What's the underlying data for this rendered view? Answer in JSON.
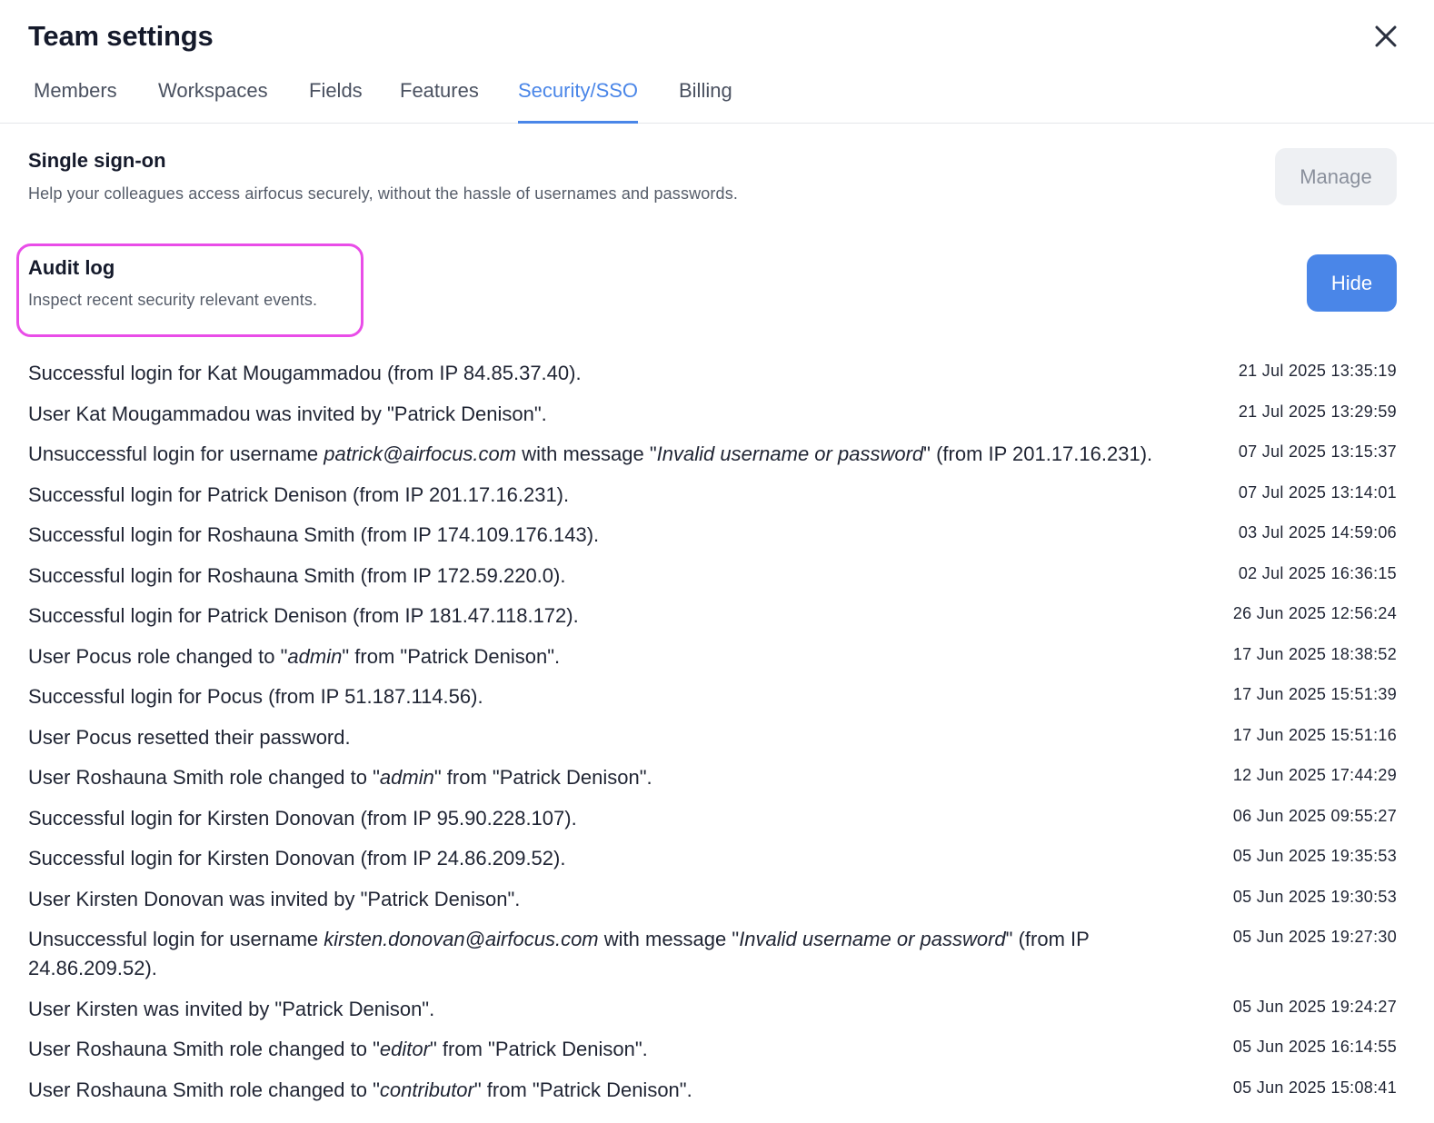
{
  "dialog": {
    "title": "Team settings",
    "close_icon": "close-icon"
  },
  "tabs": [
    {
      "label": "Members",
      "active": false
    },
    {
      "label": "Workspaces",
      "active": false
    },
    {
      "label": "Fields",
      "active": false
    },
    {
      "label": "Features",
      "active": false
    },
    {
      "label": "Security/SSO",
      "active": true
    },
    {
      "label": "Billing",
      "active": false
    }
  ],
  "sso": {
    "title": "Single sign-on",
    "description": "Help your colleagues access airfocus securely, without the hassle of usernames and passwords.",
    "button_label": "Manage"
  },
  "audit": {
    "title": "Audit log",
    "description": "Inspect recent security relevant events.",
    "button_label": "Hide"
  },
  "colors": {
    "accent": "#4a86e8",
    "highlight": "#e94de8",
    "disabled_button_bg": "#eef0f3"
  },
  "log_entries": [
    {
      "parts": [
        {
          "t": "Successful login for Kat Mougammadou (from IP 84.85.37.40)."
        }
      ],
      "time": "21 Jul 2025 13:35:19"
    },
    {
      "parts": [
        {
          "t": "User Kat Mougammadou was invited by \"Patrick Denison\"."
        }
      ],
      "time": "21 Jul 2025 13:29:59"
    },
    {
      "parts": [
        {
          "t": "Unsuccessful login for username "
        },
        {
          "t": "patrick@airfocus.com",
          "i": true
        },
        {
          "t": " with message \""
        },
        {
          "t": "Invalid username or password",
          "i": true
        },
        {
          "t": "\" (from IP 201.17.16.231)."
        }
      ],
      "time": "07 Jul 2025 13:15:37"
    },
    {
      "parts": [
        {
          "t": "Successful login for Patrick Denison (from IP 201.17.16.231)."
        }
      ],
      "time": "07 Jul 2025 13:14:01"
    },
    {
      "parts": [
        {
          "t": "Successful login for Roshauna Smith (from IP 174.109.176.143)."
        }
      ],
      "time": "03 Jul 2025 14:59:06"
    },
    {
      "parts": [
        {
          "t": "Successful login for Roshauna Smith (from IP 172.59.220.0)."
        }
      ],
      "time": "02 Jul 2025 16:36:15"
    },
    {
      "parts": [
        {
          "t": "Successful login for Patrick Denison (from IP 181.47.118.172)."
        }
      ],
      "time": "26 Jun 2025 12:56:24"
    },
    {
      "parts": [
        {
          "t": "User Pocus role changed to \""
        },
        {
          "t": "admin",
          "i": true
        },
        {
          "t": "\" from \"Patrick Denison\"."
        }
      ],
      "time": "17 Jun 2025 18:38:52"
    },
    {
      "parts": [
        {
          "t": "Successful login for Pocus (from IP 51.187.114.56)."
        }
      ],
      "time": "17 Jun 2025 15:51:39"
    },
    {
      "parts": [
        {
          "t": "User Pocus resetted their password."
        }
      ],
      "time": "17 Jun 2025 15:51:16"
    },
    {
      "parts": [
        {
          "t": "User Roshauna Smith role changed to \""
        },
        {
          "t": "admin",
          "i": true
        },
        {
          "t": "\" from \"Patrick Denison\"."
        }
      ],
      "time": "12 Jun 2025 17:44:29"
    },
    {
      "parts": [
        {
          "t": "Successful login for Kirsten Donovan (from IP 95.90.228.107)."
        }
      ],
      "time": "06 Jun 2025 09:55:27"
    },
    {
      "parts": [
        {
          "t": "Successful login for Kirsten Donovan (from IP 24.86.209.52)."
        }
      ],
      "time": "05 Jun 2025 19:35:53"
    },
    {
      "parts": [
        {
          "t": "User Kirsten Donovan was invited by \"Patrick Denison\"."
        }
      ],
      "time": "05 Jun 2025 19:30:53"
    },
    {
      "parts": [
        {
          "t": "Unsuccessful login for username "
        },
        {
          "t": "kirsten.donovan@airfocus.com",
          "i": true
        },
        {
          "t": " with message \""
        },
        {
          "t": "Invalid username or password",
          "i": true
        },
        {
          "t": "\" (from IP 24.86.209.52)."
        }
      ],
      "time": "05 Jun 2025 19:27:30"
    },
    {
      "parts": [
        {
          "t": "User Kirsten was invited by \"Patrick Denison\"."
        }
      ],
      "time": "05 Jun 2025 19:24:27"
    },
    {
      "parts": [
        {
          "t": "User Roshauna Smith role changed to \""
        },
        {
          "t": "editor",
          "i": true
        },
        {
          "t": "\" from \"Patrick Denison\"."
        }
      ],
      "time": "05 Jun 2025 16:14:55"
    },
    {
      "parts": [
        {
          "t": "User Roshauna Smith role changed to \""
        },
        {
          "t": "contributor",
          "i": true
        },
        {
          "t": "\" from \"Patrick Denison\"."
        }
      ],
      "time": "05 Jun 2025 15:08:41"
    }
  ]
}
